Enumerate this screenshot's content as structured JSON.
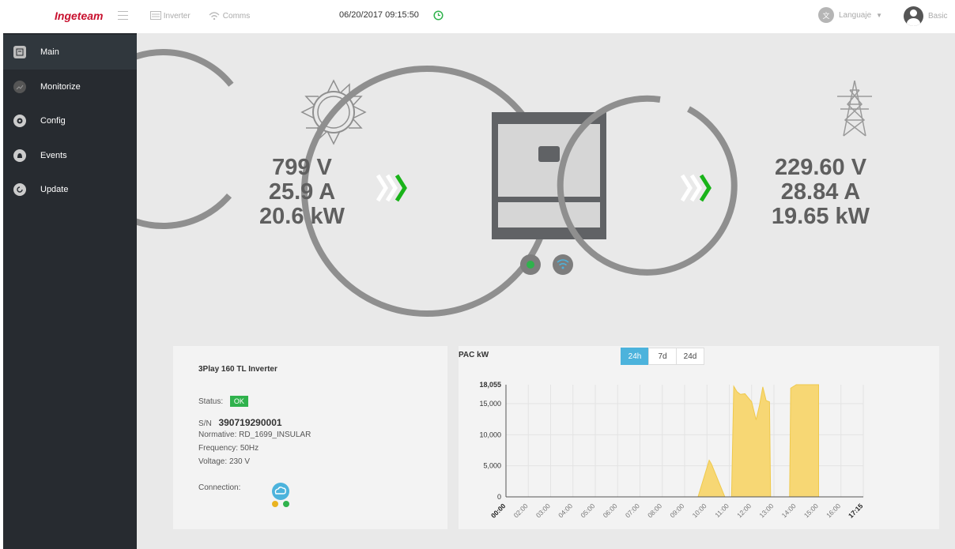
{
  "topbar": {
    "brand": "Ingeteam",
    "inverter_label": "Inverter",
    "comms_label": "Comms",
    "datetime": "06/20/2017 09:15:50",
    "language_label": "Languaje",
    "user_label": "Basic"
  },
  "sidebar": {
    "items": [
      {
        "label": "Main",
        "icon": "main-icon"
      },
      {
        "label": "Monitorize",
        "icon": "monitor-icon"
      },
      {
        "label": "Config",
        "icon": "gear-icon"
      },
      {
        "label": "Events",
        "icon": "bell-icon"
      },
      {
        "label": "Update",
        "icon": "update-icon"
      }
    ]
  },
  "pv": {
    "voltage": "799 V",
    "current": "25.9 A",
    "power": "20.6 kW"
  },
  "grid": {
    "voltage": "229.60 V",
    "current": "28.84 A",
    "power": "19.65 kW"
  },
  "info": {
    "title": "3Play 160 TL Inverter",
    "status_label": "Status:",
    "status_value": "OK",
    "sn_label": "S/N",
    "sn_value": "390719290001",
    "normative_label": "Normative:",
    "normative_value": "RD_1699_INSULAR",
    "frequency_label": "Frequency:",
    "frequency_value": "50Hz",
    "voltage_label": "Voltage:",
    "voltage_value": "230 V",
    "connection_label": "Connection:"
  },
  "chart_tabs": [
    "24h",
    "7d",
    "24d"
  ],
  "colors": {
    "accent": "#4cb3dc",
    "ok": "#2fb24c",
    "area": "#f7d774",
    "arrow": "#19b319"
  },
  "chart_data": {
    "type": "area",
    "title": "PAC kW",
    "ymax_label": "18,055",
    "y_ticks": [
      0,
      5000,
      10000,
      15000
    ],
    "y_tick_labels": [
      "0",
      "5,000",
      "10,000",
      "15,000"
    ],
    "ylim": [
      0,
      18055
    ],
    "x_tick_labels": [
      "00:00",
      "02:00",
      "03:00",
      "04:00",
      "05:00",
      "06:00",
      "07:00",
      "08:00",
      "09:00",
      "10:00",
      "11:00",
      "12:00",
      "13:00",
      "14:00",
      "15:00",
      "16:00",
      "17:15"
    ],
    "x": [
      0,
      8,
      8.6,
      9.1,
      9.2,
      9.8,
      10.1,
      10.2,
      10.35,
      10.5,
      10.7,
      11.0,
      11.2,
      11.35,
      11.5,
      11.65,
      11.8,
      11.85,
      12.0,
      12.7,
      12.75,
      13.0,
      14.0
    ],
    "y": [
      0,
      0,
      0,
      5900,
      5300,
      0,
      0,
      17800,
      16900,
      16500,
      16600,
      15300,
      12400,
      14700,
      17700,
      15500,
      15300,
      0,
      0,
      0,
      17500,
      18055,
      18055
    ]
  }
}
